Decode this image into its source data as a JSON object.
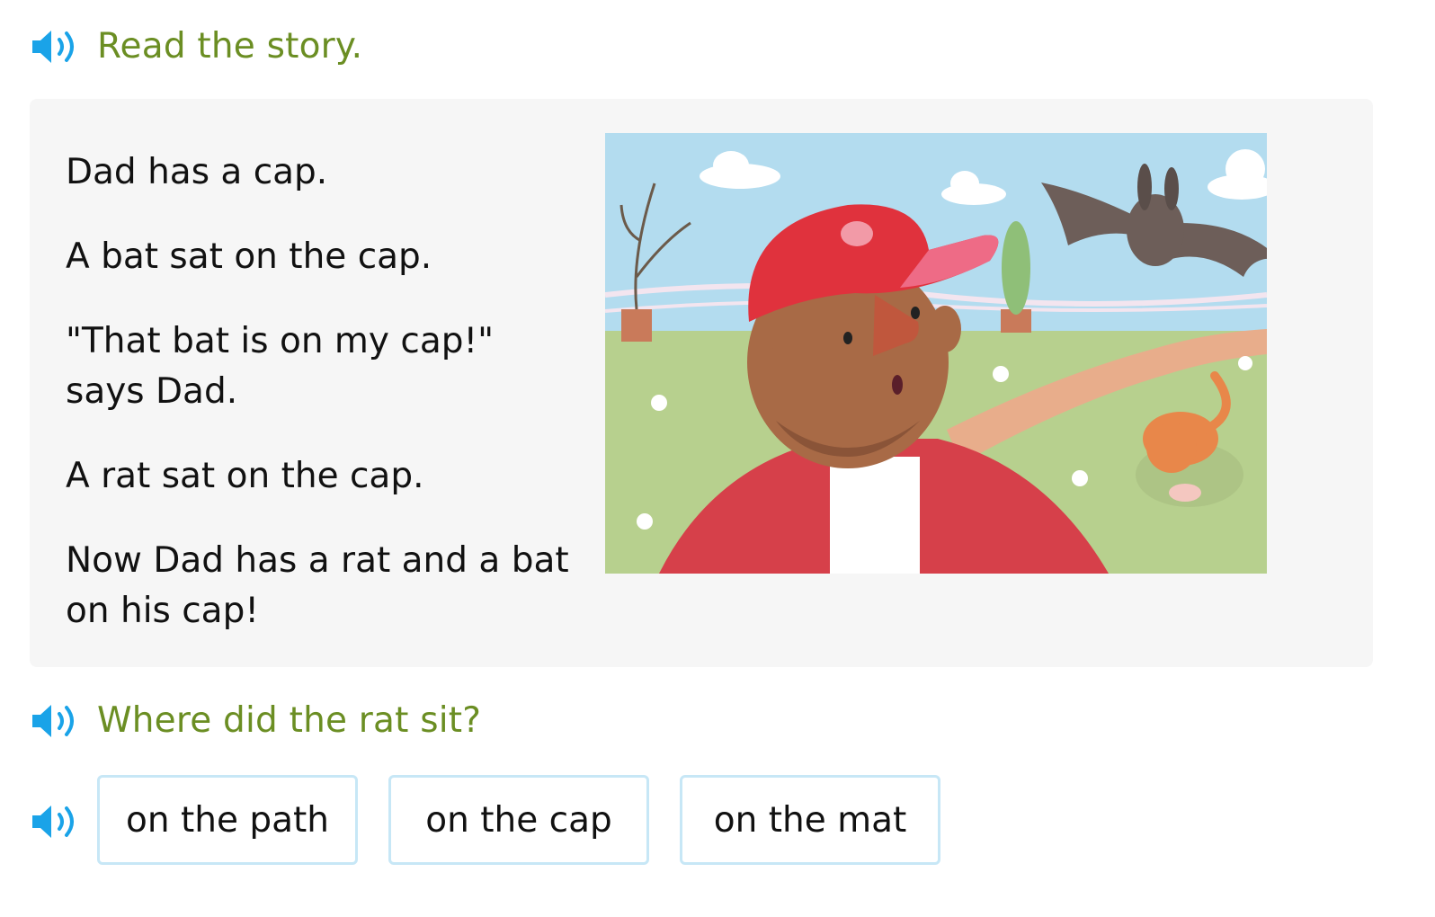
{
  "instructions": {
    "heading": "Read the story."
  },
  "story": {
    "lines": [
      "Dad has a cap.",
      "A bat sat on the cap.",
      "\"That bat is on my cap!\" says Dad.",
      "A rat sat on the cap.",
      "Now Dad has a rat and a bat on his cap!"
    ]
  },
  "question": {
    "text": "Where did the rat sit?"
  },
  "choices": [
    "on the path",
    "on the cap",
    "on the mat"
  ],
  "icons": {
    "audio": "speaker-icon"
  },
  "colors": {
    "heading": "#6b8e23",
    "speaker": "#1aa3e8",
    "choice_border": "#c7e7f6",
    "story_bg": "#f6f6f6"
  }
}
